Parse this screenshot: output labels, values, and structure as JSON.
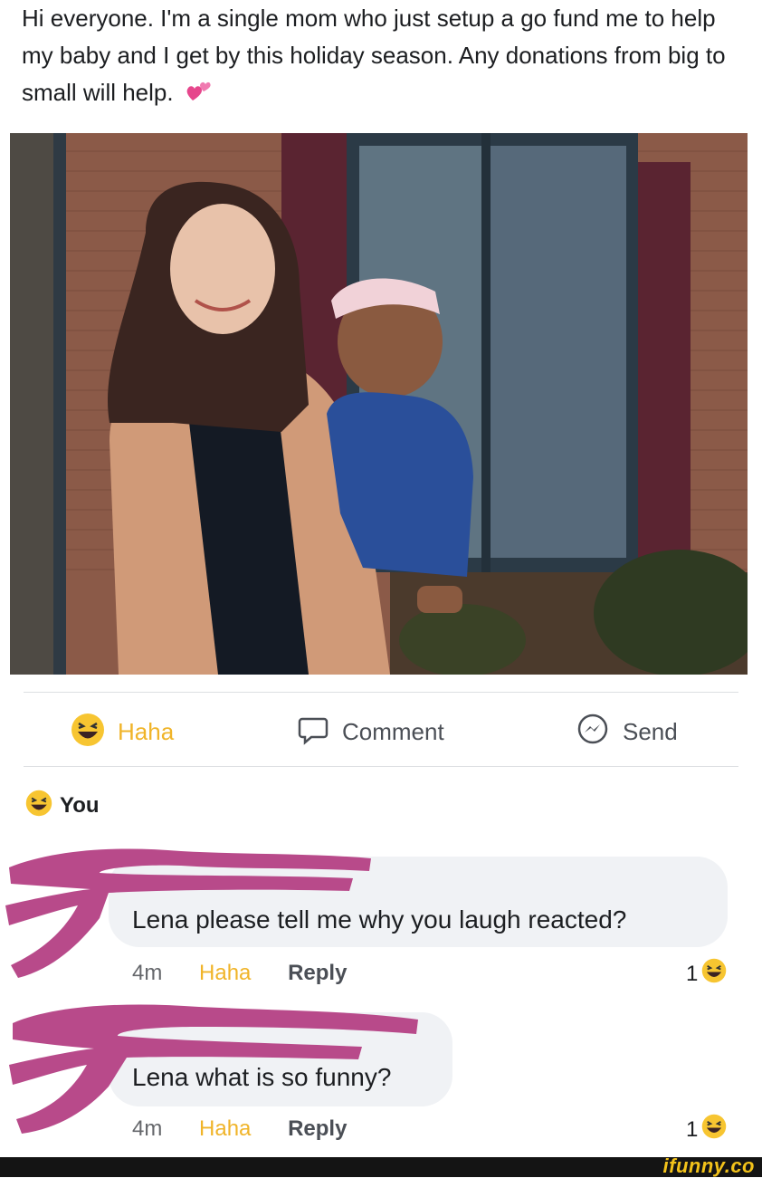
{
  "post": {
    "text": "Hi everyone. I'm a single mom who just setup a go fund me to help my baby and I get by this holiday season. Any donations from big to small will help.",
    "emoji": "two-hearts-icon"
  },
  "actions": {
    "haha": "Haha",
    "comment": "Comment",
    "send": "Send"
  },
  "reaction_by": {
    "name": "You"
  },
  "comments": [
    {
      "text": "Lena please tell me why you laugh reacted?",
      "time": "4m",
      "haha": "Haha",
      "reply": "Reply",
      "count": "1"
    },
    {
      "text": "Lena what is so funny?",
      "time": "4m",
      "haha": "Haha",
      "reply": "Reply",
      "count": "1"
    }
  ],
  "watermark": "ifunny.co",
  "colors": {
    "haha": "#f0b429",
    "redaction": "#b84a8a",
    "bubble": "#f0f2f5"
  }
}
